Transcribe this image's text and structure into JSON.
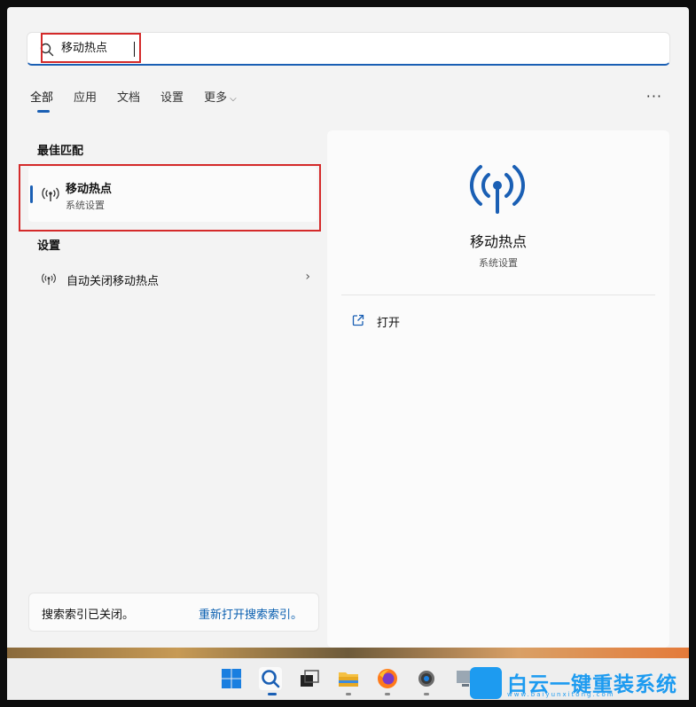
{
  "search": {
    "query": "移动热点"
  },
  "tabs": [
    {
      "label": "全部",
      "active": true
    },
    {
      "label": "应用"
    },
    {
      "label": "文档"
    },
    {
      "label": "设置"
    },
    {
      "label": "更多"
    }
  ],
  "more_menu": "···",
  "best_match": {
    "section_title": "最佳匹配",
    "title": "移动热点",
    "subtitle": "系统设置",
    "icon": "hotspot-icon"
  },
  "settings": {
    "section_title": "设置",
    "items": [
      {
        "label": "自动关闭移动热点",
        "icon": "hotspot-icon"
      }
    ]
  },
  "detail": {
    "title": "移动热点",
    "subtitle": "系统设置",
    "actions": [
      {
        "label": "打开",
        "icon": "open-external-icon"
      }
    ]
  },
  "index_notice": {
    "text": "搜索索引已关闭。",
    "link": "重新打开搜索索引。"
  },
  "watermark": {
    "text": "白云一键重装系统",
    "url": "www.baiyunxitong.com"
  },
  "colors": {
    "accent": "#1a5fb4",
    "highlight": "#d42a2a",
    "link": "#0a5fb0"
  }
}
